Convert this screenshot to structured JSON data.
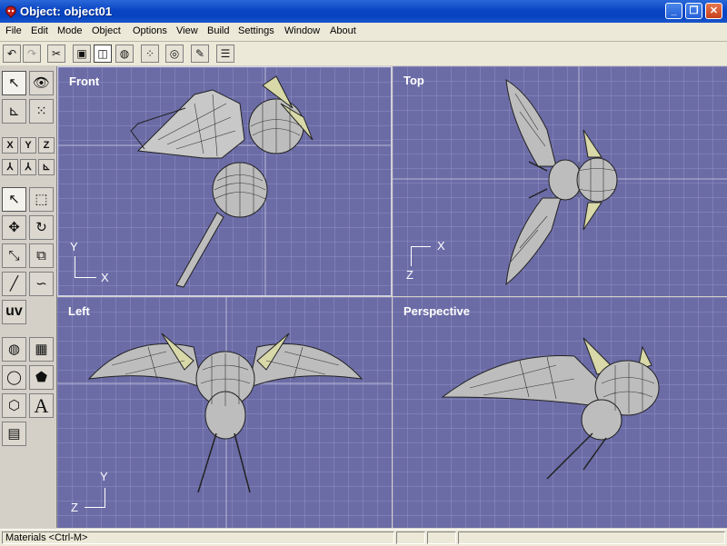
{
  "window": {
    "title": "Object: object01"
  },
  "menu": [
    "File",
    "Edit",
    "Mode",
    "Object",
    "Options",
    "View",
    "Build",
    "Settings",
    "Window",
    "About"
  ],
  "viewports": {
    "front": "Front",
    "top": "Top",
    "left": "Left",
    "perspective": "Perspective"
  },
  "axes": {
    "front": {
      "vertical": "Y",
      "horizontal": "X"
    },
    "top": {
      "vertical": "Z",
      "horizontal": "X"
    },
    "left": {
      "vertical": "Y",
      "horizontal": "Z"
    }
  },
  "left_toolbar": {
    "axis_x": "X",
    "axis_y": "Y",
    "axis_z": "Z",
    "uv": "uv",
    "text_tool": "A"
  },
  "status": {
    "left": "Materials <Ctrl-M>"
  },
  "colors": {
    "viewport_bg": "#6b6ba6",
    "titlebar": "#0a46c4",
    "model_fill": "#bdbdbd",
    "model_highlight": "#d8d8a8"
  }
}
